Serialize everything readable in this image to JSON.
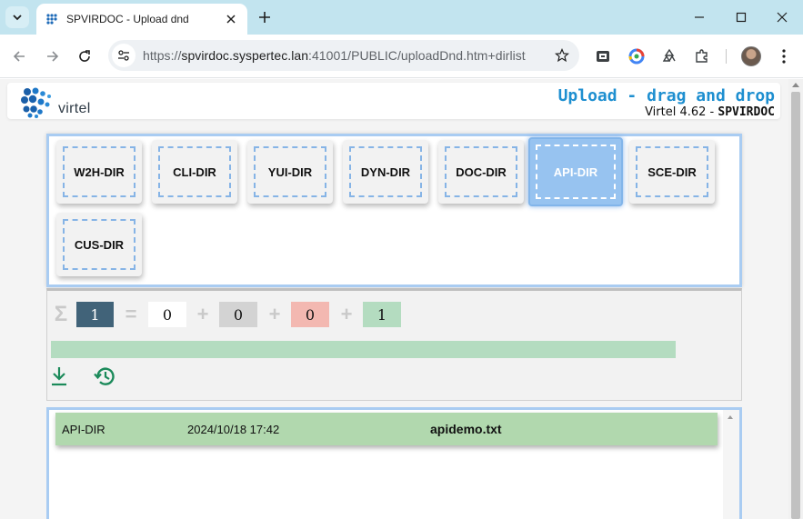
{
  "browser": {
    "tab_title": "SPVIRDOC - Upload dnd",
    "url_scheme": "https://",
    "url_host": "spvirdoc.syspertec.lan",
    "url_rest": ":41001/PUBLIC/uploadDnd.htm+dirlist",
    "icons": [
      "tab-search-icon",
      "close-icon",
      "plus-icon",
      "minimize-icon",
      "maximize-icon",
      "close-icon",
      "back-arrow-icon",
      "forward-arrow-icon",
      "reload-icon",
      "site-info-icon",
      "star-icon",
      "extension-icon",
      "puzzle-icon",
      "avatar",
      "kebab-menu-icon"
    ]
  },
  "header": {
    "logo_text": "virtel",
    "title": "Upload - drag and drop",
    "version_prefix": "Virtel 4.62 - ",
    "system_name": "SPVIRDOC",
    "title_color": "#1e8fd0"
  },
  "directories": [
    {
      "label": "W2H-DIR",
      "active": false
    },
    {
      "label": "CLI-DIR",
      "active": false
    },
    {
      "label": "YUI-DIR",
      "active": false
    },
    {
      "label": "DYN-DIR",
      "active": false
    },
    {
      "label": "DOC-DIR",
      "active": false
    },
    {
      "label": "API-DIR",
      "active": true
    },
    {
      "label": "SCE-DIR",
      "active": false
    },
    {
      "label": "CUS-DIR",
      "active": false
    }
  ],
  "stats": {
    "sigma": "Σ",
    "total": "1",
    "equals": "=",
    "plus": "+",
    "pending": "0",
    "skipped": "0",
    "failed": "0",
    "success": "1",
    "progress_fraction": 1.0,
    "colors": {
      "total": "#416379",
      "pending": "#ffffff",
      "skipped": "#d3d3d3",
      "failed": "#f3b8b1",
      "success": "#b4dcc0"
    }
  },
  "tools": {
    "download_icon": "download-icon",
    "history_icon": "history-icon"
  },
  "files": [
    {
      "directory": "API-DIR",
      "datetime": "2024/10/18 17:42",
      "name": "apidemo.txt"
    }
  ]
}
